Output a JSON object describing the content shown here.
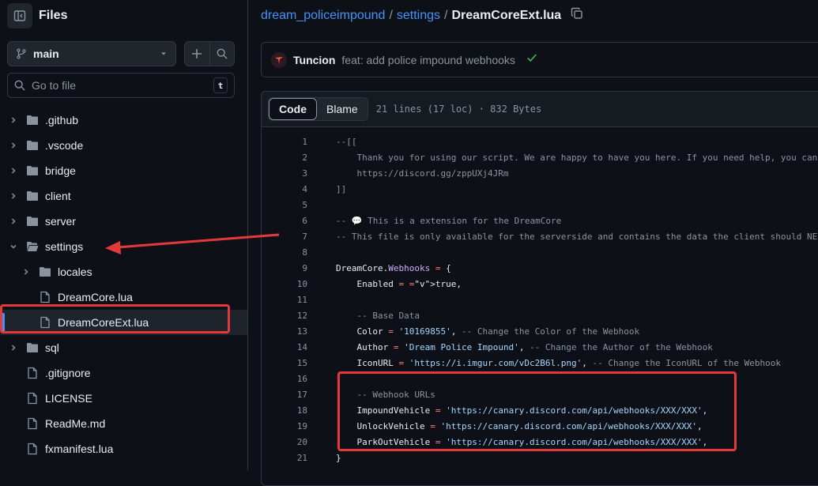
{
  "sidebar": {
    "title": "Files",
    "branch": "main",
    "search_placeholder": "Go to file",
    "search_shortcut": "t",
    "tree": [
      {
        "label": ".github",
        "type": "folder",
        "expanded": false,
        "depth": 0
      },
      {
        "label": ".vscode",
        "type": "folder",
        "expanded": false,
        "depth": 0
      },
      {
        "label": "bridge",
        "type": "folder",
        "expanded": false,
        "depth": 0
      },
      {
        "label": "client",
        "type": "folder",
        "expanded": false,
        "depth": 0
      },
      {
        "label": "server",
        "type": "folder",
        "expanded": false,
        "depth": 0
      },
      {
        "label": "settings",
        "type": "folder",
        "expanded": true,
        "depth": 0
      },
      {
        "label": "locales",
        "type": "folder",
        "expanded": false,
        "depth": 1
      },
      {
        "label": "DreamCore.lua",
        "type": "file",
        "depth": 1
      },
      {
        "label": "DreamCoreExt.lua",
        "type": "file",
        "depth": 1,
        "selected": true
      },
      {
        "label": "sql",
        "type": "folder",
        "expanded": false,
        "depth": 0
      },
      {
        "label": ".gitignore",
        "type": "file",
        "depth": 0
      },
      {
        "label": "LICENSE",
        "type": "file",
        "depth": 0
      },
      {
        "label": "ReadMe.md",
        "type": "file",
        "depth": 0
      },
      {
        "label": "fxmanifest.lua",
        "type": "file",
        "depth": 0
      }
    ]
  },
  "breadcrumb": {
    "repo": "dream_policeimpound",
    "folder": "settings",
    "file": "DreamCoreExt.lua"
  },
  "commit": {
    "author": "Tuncion",
    "message": "feat: add police impound webhooks"
  },
  "code": {
    "tab_code": "Code",
    "tab_blame": "Blame",
    "meta": "21 lines (17 loc) · 832 Bytes",
    "lines": [
      "--[[",
      "    Thank you for using our script. We are happy to have you here. If you need help, you can",
      "    https://discord.gg/zppUXj4JRm",
      "]]",
      "",
      "-- 💬 This is a extension for the DreamCore",
      "-- This file is only available for the serverside and contains the data the client should NEV",
      "",
      "DreamCore.Webhooks = {",
      "    Enabled = true,",
      "",
      "    -- Base Data",
      "    Color = '10169855', -- Change the Color of the Webhook",
      "    Author = 'Dream Police Impound', -- Change the Author of the Webhook",
      "    IconURL = 'https://i.imgur.com/vDc2B6l.png', -- Change the IconURL of the Webhook",
      "",
      "    -- Webhook URLs",
      "    ImpoundVehicle = 'https://canary.discord.com/api/webhooks/XXX/XXX',",
      "    UnlockVehicle = 'https://canary.discord.com/api/webhooks/XXX/XXX',",
      "    ParkOutVehicle = 'https://canary.discord.com/api/webhooks/XXX/XXX',",
      "}"
    ]
  },
  "colors": {
    "accent": "#4493f8",
    "highlight": "#e5383b",
    "success": "#3fb950"
  }
}
